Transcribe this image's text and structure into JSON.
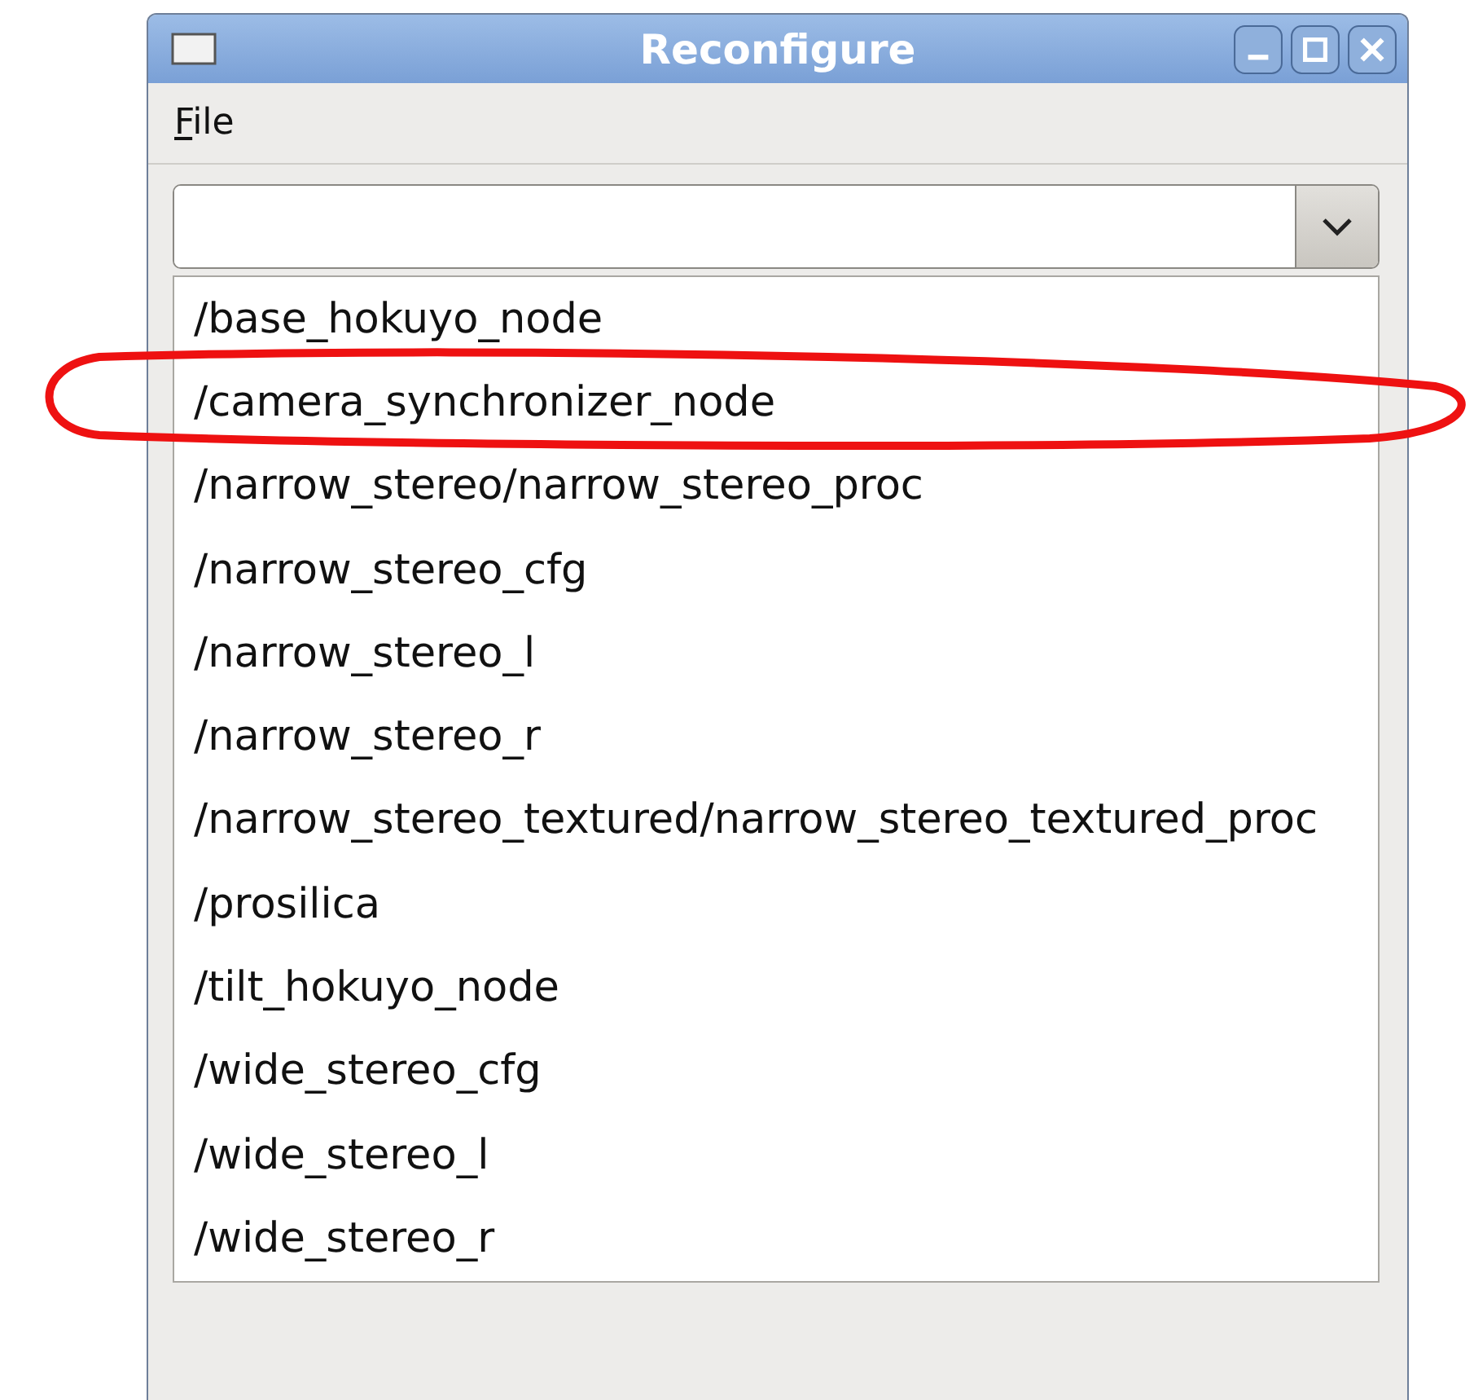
{
  "window": {
    "title": "Reconfigure"
  },
  "menu": [
    {
      "label": "File",
      "underlined_first_letter": true
    }
  ],
  "items": [
    {
      "label": "/base_hokuyo_node",
      "circled": false
    },
    {
      "label": "/camera_synchronizer_node",
      "circled": true
    },
    {
      "label": "/narrow_stereo/narrow_stereo_proc",
      "circled": false
    },
    {
      "label": "/narrow_stereo_cfg",
      "circled": false
    },
    {
      "label": "/narrow_stereo_l",
      "circled": false
    },
    {
      "label": "/narrow_stereo_r",
      "circled": false
    },
    {
      "label": "/narrow_stereo_textured/narrow_stereo_textured_proc",
      "circled": false
    },
    {
      "label": "/prosilica",
      "circled": false
    },
    {
      "label": "/tilt_hokuyo_node",
      "circled": false
    },
    {
      "label": "/wide_stereo_cfg",
      "circled": false
    },
    {
      "label": "/wide_stereo_l",
      "circled": false
    },
    {
      "label": "/wide_stereo_r",
      "circled": false
    }
  ]
}
